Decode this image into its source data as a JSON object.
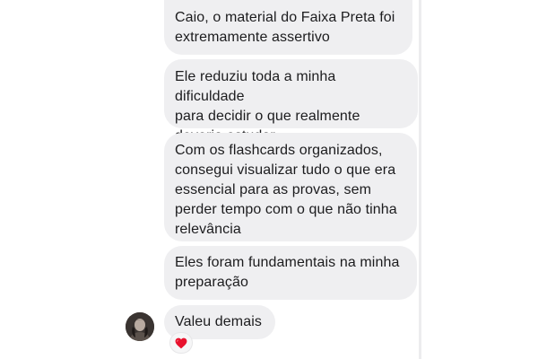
{
  "conversation": {
    "messages": [
      {
        "text": "Caio, o material do Faixa Preta foi\nextremamente assertivo"
      },
      {
        "text": "Ele reduziu toda a minha dificuldade\npara decidir o que realmente\ndeveria estudar."
      },
      {
        "text": "Com os flashcards organizados,\nconsegui visualizar tudo o que era\nessencial para as provas, sem\nperder tempo com o que não tinha\nrelevância"
      },
      {
        "text": "Eles foram fundamentais na minha\npreparação"
      },
      {
        "text": "Valeu demais"
      }
    ],
    "reaction": {
      "icon": "heart-icon",
      "color": "#e8112d"
    },
    "avatar": {
      "icon": "avatar"
    }
  },
  "colors": {
    "bubble_background": "#efeff1",
    "text": "#1c1c1e"
  }
}
